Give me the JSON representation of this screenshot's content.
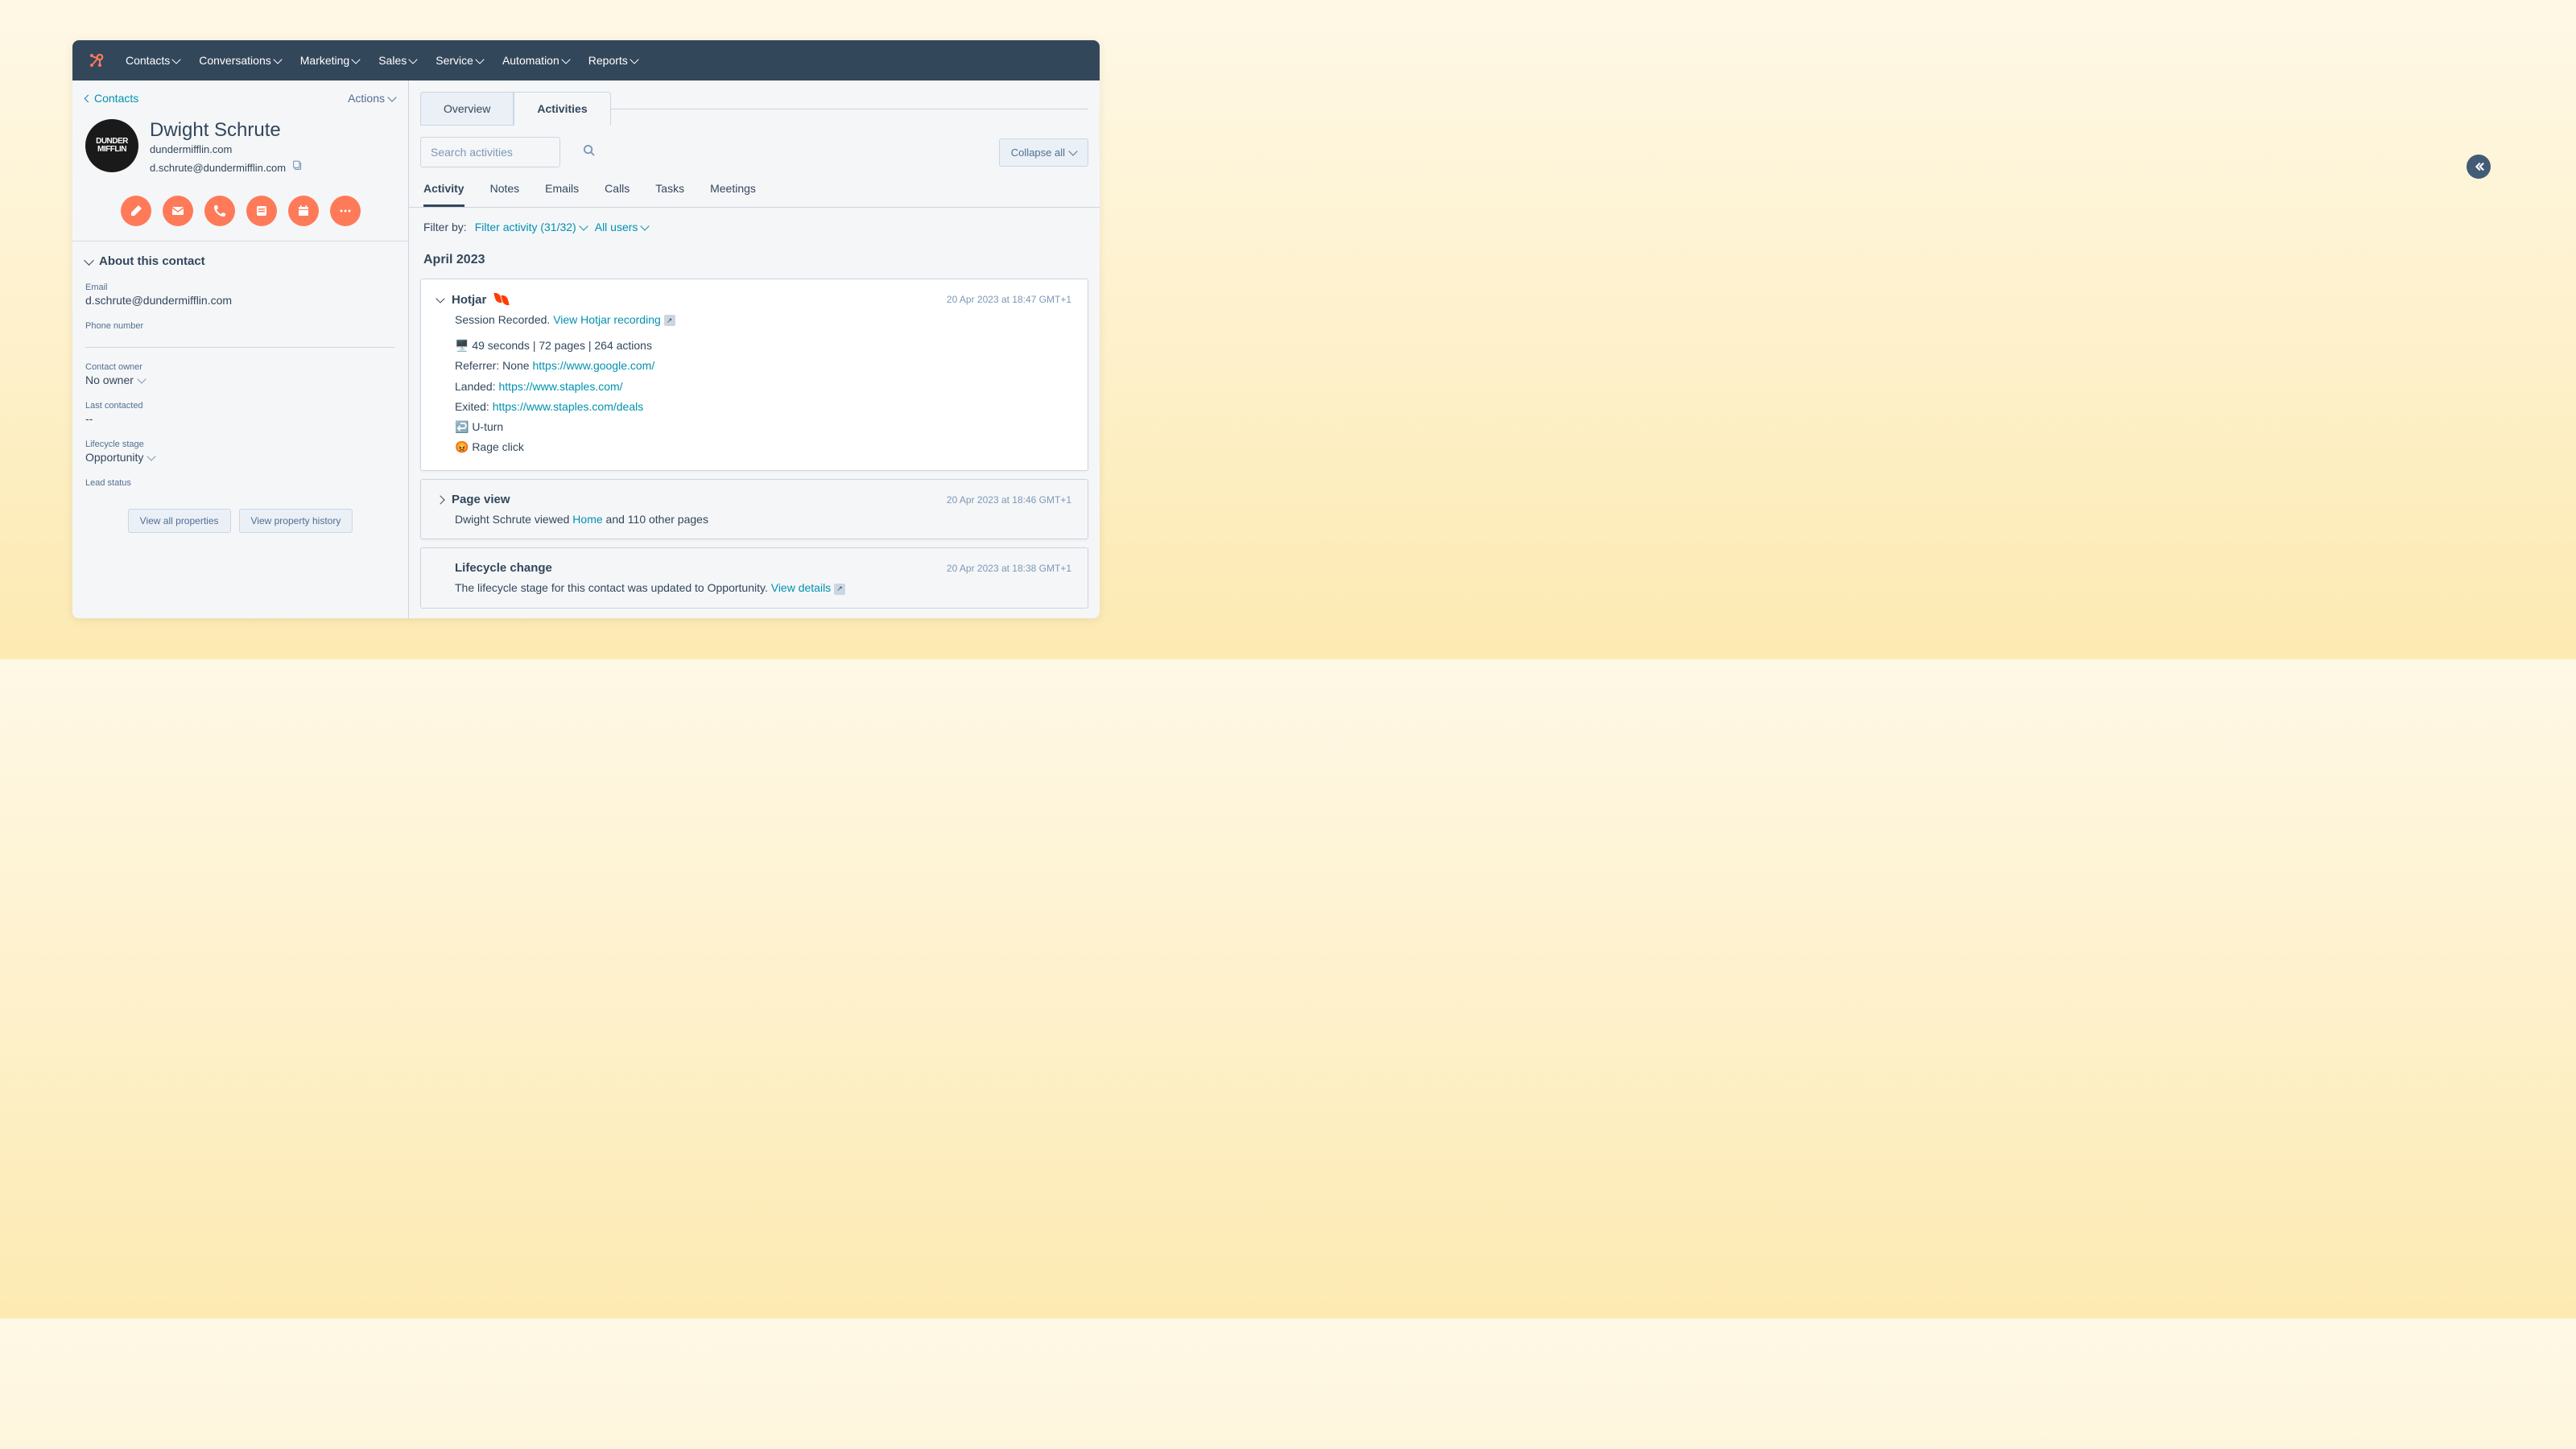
{
  "topnav": {
    "items": [
      "Contacts",
      "Conversations",
      "Marketing",
      "Sales",
      "Service",
      "Automation",
      "Reports"
    ]
  },
  "sidebar": {
    "breadcrumb": "Contacts",
    "actions": "Actions",
    "contact": {
      "name": "Dwight Schrute",
      "domain": "dundermifflin.com",
      "email": "d.schrute@dundermifflin.com",
      "avatar_lines": [
        "DUNDER",
        "MIFFLIN"
      ]
    },
    "about_title": "About this contact",
    "properties": {
      "email_label": "Email",
      "email_value": "d.schrute@dundermifflin.com",
      "phone_label": "Phone number",
      "phone_value": "",
      "owner_label": "Contact owner",
      "owner_value": "No owner",
      "last_contacted_label": "Last contacted",
      "last_contacted_value": "--",
      "lifecycle_label": "Lifecycle stage",
      "lifecycle_value": "Opportunity",
      "lead_status_label": "Lead status",
      "lead_status_value": ""
    },
    "view_all": "View all properties",
    "view_history": "View property history"
  },
  "main": {
    "tabs": {
      "overview": "Overview",
      "activities": "Activities"
    },
    "search_placeholder": "Search activities",
    "collapse_label": "Collapse all",
    "subtabs": [
      "Activity",
      "Notes",
      "Emails",
      "Calls",
      "Tasks",
      "Meetings"
    ],
    "filter": {
      "label": "Filter by:",
      "activity": "Filter activity (31/32)",
      "users": "All users"
    },
    "month": "April 2023",
    "cards": [
      {
        "title": "Hotjar",
        "time": "20 Apr 2023 at 18:47 GMT+1",
        "subtitle_prefix": "Session Recorded.",
        "subtitle_link": "View Hotjar recording",
        "stats": "🖥️ 49 seconds | 72 pages | 264 actions",
        "referrer_label": "Referrer: None",
        "referrer_link": "https://www.google.com/",
        "landed_label": "Landed:",
        "landed_link": "https://www.staples.com/",
        "exited_label": "Exited:",
        "exited_link": "https://www.staples.com/deals",
        "uturn": "↩️ U-turn",
        "rage": "😡 Rage click"
      },
      {
        "title": "Page view",
        "time": "20 Apr 2023 at 18:46 GMT+1",
        "body_prefix": "Dwight Schrute viewed ",
        "body_link": "Home",
        "body_suffix": " and 110 other pages"
      },
      {
        "title": "Lifecycle change",
        "time": "20 Apr 2023 at 18:38 GMT+1",
        "body": "The lifecycle stage for this contact was updated to Opportunity.",
        "details_link": "View details"
      }
    ]
  }
}
